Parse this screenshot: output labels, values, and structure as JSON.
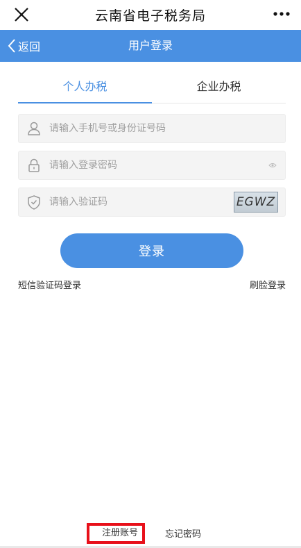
{
  "window": {
    "title": "云南省电子税务局",
    "close_icon": "close-icon",
    "more_icon": "more-dots-icon"
  },
  "navbar": {
    "back_label": "返回",
    "title": "用户登录",
    "background_color": "#4a90e2"
  },
  "tabs": [
    {
      "label": "个人办税",
      "active": true
    },
    {
      "label": "企业办税",
      "active": false
    }
  ],
  "form": {
    "account": {
      "placeholder": "请输入手机号或身份证号码",
      "value": "",
      "icon": "user-icon"
    },
    "password": {
      "placeholder": "请输入登录密码",
      "value": "",
      "icon": "lock-icon",
      "toggle_icon": "eye-icon"
    },
    "captcha": {
      "placeholder": "请输入验证码",
      "value": "",
      "icon": "shield-icon",
      "image_text": "EGWZ"
    }
  },
  "login_button": "登录",
  "links": {
    "sms_login": "短信验证码登录",
    "face_login": "刷脸登录",
    "register": "注册账号",
    "forgot_password": "忘记密码"
  },
  "colors": {
    "accent": "#4a90e2",
    "highlight": "#e8101a"
  }
}
